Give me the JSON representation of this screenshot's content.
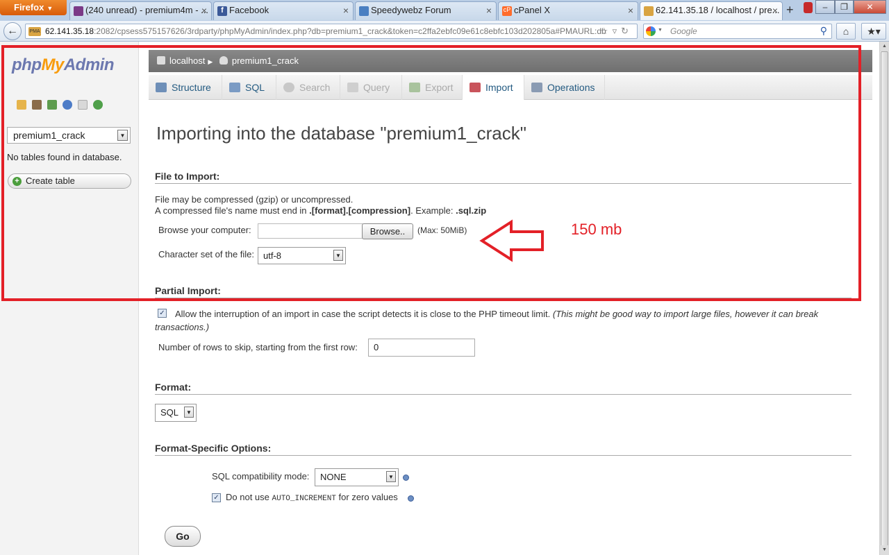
{
  "browser": {
    "menu_label": "Firefox",
    "tabs": [
      {
        "title": "(240 unread) - premium4m - ..."
      },
      {
        "title": "Facebook"
      },
      {
        "title": "Speedywebz Forum"
      },
      {
        "title": "cPanel X"
      },
      {
        "title": "62.141.35.18 / localhost / pre..."
      }
    ],
    "url_host": "62.141.35.18",
    "url_rest": ":2082/cpsess575157626/3rdparty/phpMyAdmin/index.php?db=premium1_crack&token=c2ffa2ebfc09e61c8ebfc103d202805a#PMAURL:db",
    "search_placeholder": "Google",
    "favicon_text": "PMA"
  },
  "sidebar": {
    "logo_php": "php",
    "logo_my": "My",
    "logo_admin": "Admin",
    "db_selected": "premium1_crack",
    "no_tables_text": "No tables found in database.",
    "create_table_label": "Create table"
  },
  "breadcrumb": {
    "server": "localhost",
    "database": "premium1_crack"
  },
  "tabs": [
    {
      "label": "Structure",
      "state": "normal"
    },
    {
      "label": "SQL",
      "state": "normal"
    },
    {
      "label": "Search",
      "state": "disabled"
    },
    {
      "label": "Query",
      "state": "disabled"
    },
    {
      "label": "Export",
      "state": "disabled"
    },
    {
      "label": "Import",
      "state": "active"
    },
    {
      "label": "Operations",
      "state": "normal"
    }
  ],
  "main": {
    "title": "Importing into the database \"premium1_crack\"",
    "file_section": "File to Import:",
    "compress_line1": "File may be compressed (gzip) or uncompressed.",
    "compress_line2_a": "A compressed file's name must end in ",
    "compress_line2_b": ".[format].[compression]",
    "compress_line2_c": ". Example: ",
    "compress_line2_d": ".sql.zip",
    "browse_label": "Browse your computer:",
    "browse_button": "Browse..",
    "max_size": "(Max: 50MiB)",
    "charset_label": "Character set of the file:",
    "charset_value": "utf-8",
    "partial_section": "Partial Import:",
    "allow_interrupt": "Allow the interruption of an import in case the script detects it is close to the PHP timeout limit.",
    "allow_interrupt_note": "(This might be good way to import large files, however it can break transactions.)",
    "skip_rows_label": "Number of rows to skip, starting from the first row:",
    "skip_rows_value": "0",
    "format_section": "Format:",
    "format_value": "SQL",
    "fs_options_section": "Format-Specific Options:",
    "compat_label": "SQL compatibility mode:",
    "compat_value": "NONE",
    "auto_inc_a": "Do not use ",
    "auto_inc_code": "AUTO_INCREMENT",
    "auto_inc_b": " for zero values",
    "go_button": "Go"
  },
  "annotation": {
    "text": "150 mb",
    "color": "#e32027"
  },
  "colors": {
    "accent": "#235a81",
    "logo_blue": "#6c78af",
    "logo_orange": "#f89c0e"
  }
}
